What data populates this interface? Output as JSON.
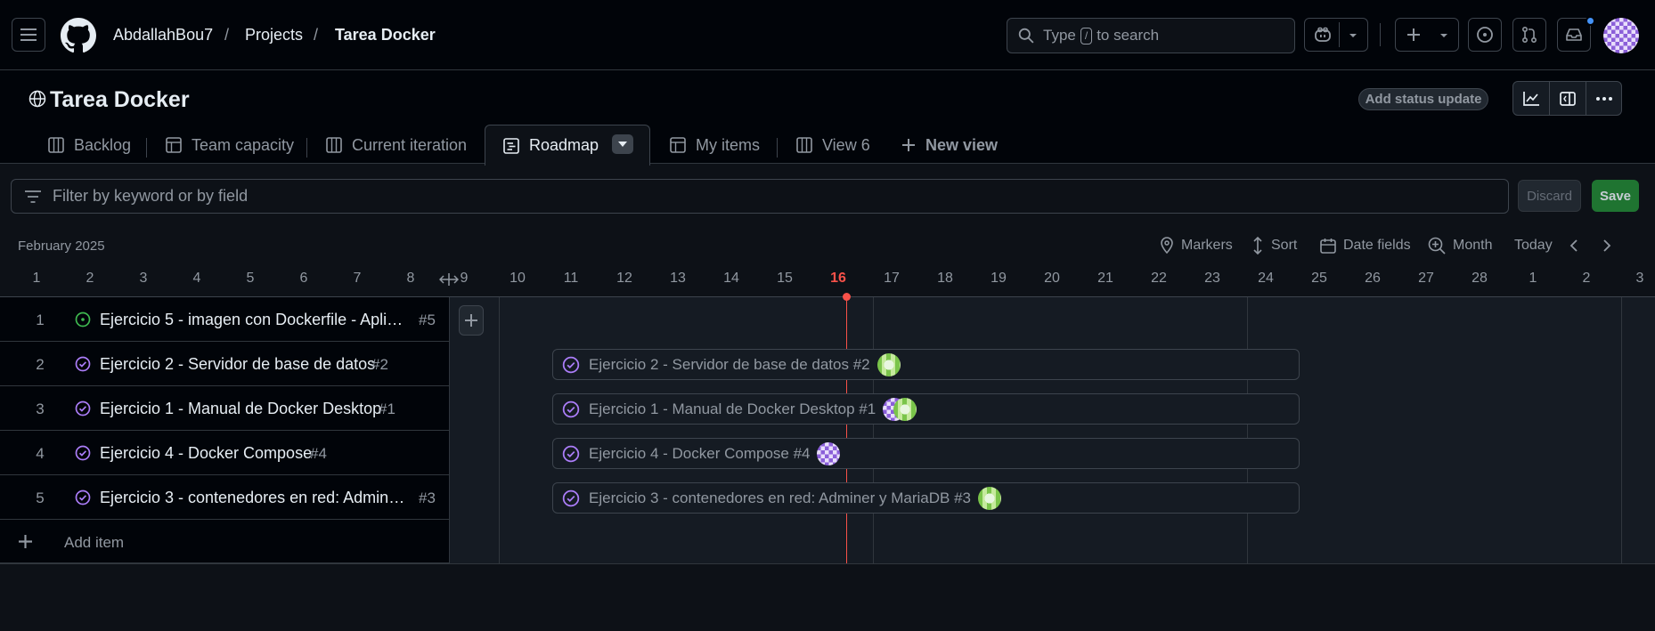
{
  "header": {
    "user": "AbdallahBou7",
    "projects": "Projects",
    "project": "Tarea Docker",
    "search_prefix": "Type",
    "search_key": "/",
    "search_suffix": "to search"
  },
  "project": {
    "title": "Tarea Docker",
    "status_button": "Add status update"
  },
  "tabs": [
    {
      "label": "Backlog",
      "icon": "board-icon"
    },
    {
      "label": "Team capacity",
      "icon": "table-icon"
    },
    {
      "label": "Current iteration",
      "icon": "board-icon"
    },
    {
      "label": "Roadmap",
      "icon": "roadmap-icon",
      "active": true
    },
    {
      "label": "My items",
      "icon": "table-icon"
    },
    {
      "label": "View 6",
      "icon": "board-icon"
    },
    {
      "label": "New view",
      "icon": "plus-icon"
    }
  ],
  "filter": {
    "placeholder": "Filter by keyword or by field",
    "discard": "Discard",
    "save": "Save"
  },
  "timeline": {
    "month": "February 2025",
    "controls": {
      "markers": "Markers",
      "sort": "Sort",
      "date_fields": "Date fields",
      "zoom": "Month",
      "today": "Today"
    },
    "days": [
      "1",
      "2",
      "3",
      "4",
      "5",
      "6",
      "7",
      "8",
      "9",
      "10",
      "11",
      "12",
      "13",
      "14",
      "15",
      "16",
      "17",
      "18",
      "19",
      "20",
      "21",
      "22",
      "23",
      "24",
      "25",
      "26",
      "27",
      "28",
      "1",
      "2",
      "3"
    ],
    "today_day": "16"
  },
  "items": [
    {
      "num": "1",
      "title": "Ejercicio 5 - imagen con Dockerfile - Aplica...",
      "ref": "#5",
      "status": "open",
      "bar": null
    },
    {
      "num": "2",
      "title": "Ejercicio 2 - Servidor de base de datos",
      "ref": "#2",
      "status": "closed",
      "bar": "Ejercicio 2 - Servidor de base de datos #2",
      "avatars": [
        "green"
      ]
    },
    {
      "num": "3",
      "title": "Ejercicio 1 - Manual de Docker Desktop",
      "ref": "#1",
      "status": "closed",
      "bar": "Ejercicio 1 - Manual de Docker Desktop #1",
      "avatars": [
        "purple",
        "green"
      ]
    },
    {
      "num": "4",
      "title": "Ejercicio 4 - Docker Compose",
      "ref": "#4",
      "status": "closed",
      "bar": "Ejercicio 4 - Docker Compose #4",
      "avatars": [
        "purple"
      ]
    },
    {
      "num": "5",
      "title": "Ejercicio 3 - contenedores en red: Adminer ...",
      "ref": "#3",
      "status": "closed",
      "bar": "Ejercicio 3 - contenedores en red: Adminer y MariaDB #3",
      "avatars": [
        "green"
      ]
    }
  ],
  "add_item": "Add item",
  "colors": {
    "accent_purple": "#ab7df8",
    "open_green": "#3fb950",
    "today_red": "#f85149",
    "save_green": "#238636"
  }
}
